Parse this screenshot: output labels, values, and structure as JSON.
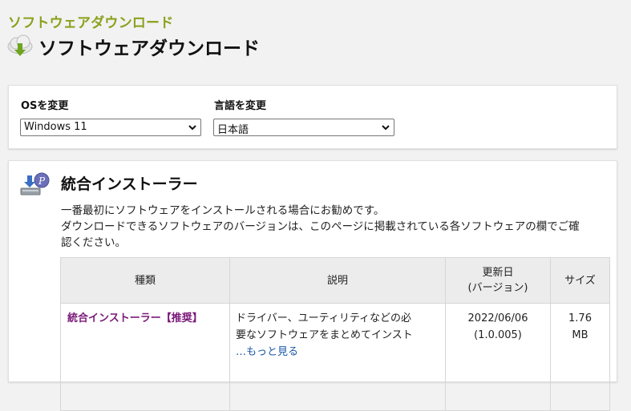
{
  "breadcrumb": "ソフトウェアダウンロード",
  "page_title": "ソフトウェアダウンロード",
  "os_selector": {
    "label": "OSを変更",
    "value": "Windows 11"
  },
  "language_selector": {
    "label": "言語を変更",
    "value": "日本語"
  },
  "section": {
    "title": "統合インストーラー",
    "description_line1": "一番最初にソフトウェアをインストールされる場合にお勧めです。",
    "description_line2": "ダウンロードできるソフトウェアのバージョンは、このページに掲載されている各ソフトウェアの欄でご確",
    "description_line3": "認ください。"
  },
  "table": {
    "headers": {
      "type": "種類",
      "description": "説明",
      "updated_line1": "更新日",
      "updated_line2": "(バージョン)",
      "size": "サイズ"
    },
    "rows": [
      {
        "name": "統合インストーラー【推奨】",
        "desc_line1": "ドライバー、ユーティリティなどの必",
        "desc_line2": "要なソフトウェアをまとめてインスト",
        "more": "…もっと見る",
        "date": "2022/06/06",
        "version": "(1.0.005)",
        "size_line1": "1.76",
        "size_line2": "MB"
      }
    ]
  },
  "colors": {
    "breadcrumb": "#8aa11b",
    "product_name": "#7a1878",
    "link": "#1a56a8"
  },
  "icons": [
    "cloud-download-icon",
    "chevron-down-icon",
    "installer-icon"
  ]
}
